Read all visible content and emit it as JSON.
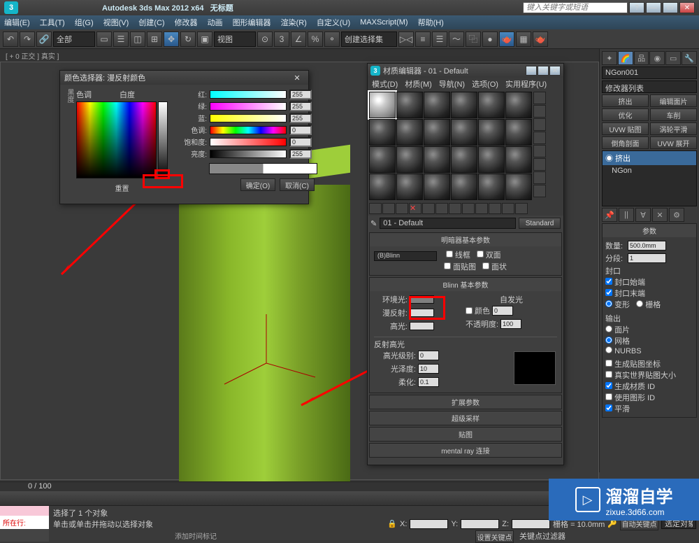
{
  "app": {
    "title": "Autodesk 3ds Max  2012 x64",
    "doc": "无标题",
    "search_placeholder": "键入关键字或短语"
  },
  "menubar": [
    "编辑(E)",
    "工具(T)",
    "组(G)",
    "视图(V)",
    "创建(C)",
    "修改器",
    "动画",
    "图形编辑器",
    "渲染(R)",
    "自定义(U)",
    "MAXScript(M)",
    "帮助(H)"
  ],
  "toolbar": {
    "selectset": "全部",
    "cmdset": "创建选择集"
  },
  "viewport_label": "[ + 0 正交 ] 真实 ]",
  "colorpicker": {
    "title": "颜色选择器: 漫反射颜色",
    "hue_label": "色调",
    "white_label": "白度",
    "black_label": "黑度",
    "channels": {
      "r": {
        "label": "红:",
        "val": 255,
        "bar": "linear-gradient(90deg,#0ff,#fff)"
      },
      "g": {
        "label": "绿:",
        "val": 255,
        "bar": "linear-gradient(90deg,#f0f,#fff)"
      },
      "b": {
        "label": "蓝:",
        "val": 255,
        "bar": "linear-gradient(90deg,#ff0,#fff)"
      },
      "h": {
        "label": "色调:",
        "val": 0,
        "bar": "linear-gradient(90deg,#f00,#ff0,#0f0,#0ff,#00f,#f0f,#f00)"
      },
      "s": {
        "label": "饱和度:",
        "val": 0,
        "bar": "linear-gradient(90deg,#fff,#f00)"
      },
      "v": {
        "label": "亮度:",
        "val": 255,
        "bar": "linear-gradient(90deg,#000,#fff)"
      }
    },
    "reset": "重置",
    "ok": "确定(O)",
    "cancel": "取消(C)"
  },
  "mateditor": {
    "title": "材质编辑器 - 01 - Default",
    "menu": [
      "模式(D)",
      "材质(M)",
      "导航(N)",
      "选项(O)",
      "实用程序(U)"
    ],
    "mtlname": "01 - Default",
    "mtltype": "Standard",
    "roll_shader_h": "明暗器基本参数",
    "shader": "(B)Blinn",
    "cb_wire": "线框",
    "cb_2side": "双面",
    "cb_facemap": "面贴图",
    "cb_faceted": "面状",
    "roll_blinn_h": "Blinn 基本参数",
    "ambient": "环境光:",
    "diffuse": "漫反射:",
    "specular": "高光:",
    "selfillum_h": "自发光",
    "selfillum_cb": "颜色",
    "selfillum_val": 0,
    "opacity_l": "不透明度:",
    "opacity_val": 100,
    "roll_spec": "反射高光",
    "speclevel": "高光级别:",
    "speclevel_v": 0,
    "gloss": "光泽度:",
    "gloss_v": 10,
    "soften": "柔化:",
    "soften_v": 0.1,
    "roll_ext": "扩展参数",
    "roll_ss": "超级采样",
    "roll_maps": "贴图",
    "roll_mr": "mental ray 连接"
  },
  "rightpanel": {
    "objname": "NGon001",
    "modlist_label": "修改器列表",
    "buttons": {
      "extrude": "挤出",
      "editpoly": "编辑面片",
      "optimize": "优化",
      "lathe": "车削",
      "uvwmap": "UVW 贴图",
      "turbosmooth": "涡轮平滑",
      "bevelprof": "倒角剖面",
      "uvwunwrap": "UVW 展开"
    },
    "stack": [
      "挤出",
      "NGon"
    ],
    "roll_params": "参数",
    "amount_l": "数量:",
    "amount_v": "500.0mm",
    "segs_l": "分段:",
    "segs_v": 1,
    "cap_l": "封口",
    "cap_start": "封口始端",
    "cap_end": "封口末端",
    "morph": "变形",
    "grid": "栅格",
    "output_l": "输出",
    "patch": "面片",
    "mesh": "网格",
    "nurbs": "NURBS",
    "genmapcoords": "生成贴图坐标",
    "realworld": "真实世界贴图大小",
    "genmatids": "生成材质 ID",
    "useshapeids": "使用图形 ID",
    "smooth": "平滑"
  },
  "timeline": {
    "pos": "0 / 100"
  },
  "status": {
    "at": "所在行:",
    "sel": "选择了 1 个对象",
    "prompt": "单击或单击并拖动以选择对象",
    "addtime": "添加时间标记",
    "x": "X:",
    "y": "Y:",
    "z": "Z:",
    "grid": "栅格 = 10.0mm",
    "autokey": "自动关键点",
    "setkey": "设置关键点",
    "selset": "选定对象",
    "keyfilter": "关键点过滤器"
  },
  "watermark": {
    "brand": "溜溜自学",
    "url": "zixue.3d66.com"
  }
}
